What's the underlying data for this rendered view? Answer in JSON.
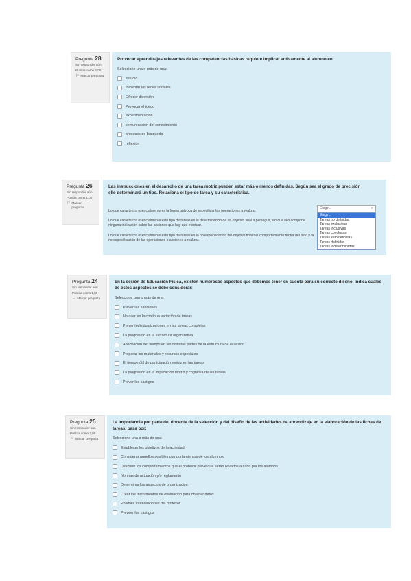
{
  "q28": {
    "number_prefix": "Pregunta",
    "number": "28",
    "status": "Sin responder aún",
    "score": "Puntúa como 2,00",
    "flag_label": "Marcar pregunta",
    "question": "Provocar aprendizajes relevantes de las competencias básicas requiere implicar activamente al alumno en:",
    "prompt": "Seleccione una o más de una:",
    "options": [
      "estudio",
      "fomentar las redes sociales",
      "Ofrecer diversión",
      "Provocar el juego",
      "experimentación",
      "comunicación del conocimiento",
      "procesos de búsqueda",
      "reflexión"
    ]
  },
  "q26": {
    "number_prefix": "Pregunta",
    "number": "26",
    "status": "Sin responder aún",
    "score": "Puntúa como 1,00",
    "flag_label": "Marcar pregunta",
    "question": "Las instrucciones en el desarrollo de una tarea motriz pueden estar más o menos definidas. Según sea el grado de precisión ello determinará un tipo. Relaciona el tipo de tarea y su característica.",
    "row1": "Lo que caracteriza esencialmente es la forma unívoca de especificar las operaciones a realizar.",
    "row2": "Lo que caracteriza esencialmente este tipo de tareas es la determinación de un objetivo final a perseguir, sin que ello comporte ninguna indicación sobre las acciones que hay que efectuar.",
    "row3": "Lo que caracteriza esencialmente este tipo de tareas es la no especificación del objetivo final del comportamiento motor del niño y la no especificación de las operaciones o acciones a realizar.",
    "select_value": "Elegir...",
    "dropdown_options": [
      "Elegir...",
      "Tareas no definidas",
      "Tareas exclusivas",
      "Tareas inclusivas",
      "Tareas conclusas",
      "Tareas semidefinidas",
      "Tareas definidas",
      "Tareas indeterminadas"
    ]
  },
  "q24": {
    "number_prefix": "Pregunta",
    "number": "24",
    "status": "Sin responder aún",
    "score": "Puntúa como 1,00",
    "flag_label": "Marcar pregunta",
    "question": "En la sesión de Educación Física, existen numerosos aspectos que debemos tener en cuenta para su correcto diseño, indica cuales de estos aspectos se debe considerar:",
    "prompt": "Seleccione una o más de una:",
    "options": [
      "Prever las sanciones",
      "No caer en la continua variación de tareas",
      "Prever individualizaciones en las tareas complejas",
      "La progresión en la estructura organizativa",
      "Adecuación del tiempo en las distintas partes de la estructura de la sesión",
      "Preparar los materiales y recursos especiales",
      "El tiempo útil de participación motriz en las tareas",
      "La progresión en la implicación motriz y cognitiva de las tareas",
      "Prever los castigos"
    ]
  },
  "q25": {
    "number_prefix": "Pregunta",
    "number": "25",
    "status": "Sin responder aún",
    "score": "Puntúa como 2,00",
    "flag_label": "Marcar pregunta",
    "question": "La importancia por parte del docente de la selección y del diseño de las actividades de aprendizaje en la elaboración de las fichas de tareas, pasa por:",
    "prompt": "Seleccione una o más de una:",
    "options": [
      "Establecer los objetivos de la actividad",
      "Considerar aquellos posibles comportamientos de los alumnos",
      "Describir los comportamientos que el profesor prevé que serán llevados a cabo por los alumnos",
      "Normas de actuación y/o reglamento",
      "Determinar los aspectos  de organización",
      "Crear los instrumentos de evaluación para obtener datos",
      "Posibles intervenciones del profesor",
      "Preveer los castigos"
    ]
  },
  "icons": {
    "flag": "flag-icon"
  },
  "colors": {
    "content_bg": "#d9edf7",
    "info_bg": "#f0f0f0",
    "dropdown_highlight": "#3875d7"
  }
}
